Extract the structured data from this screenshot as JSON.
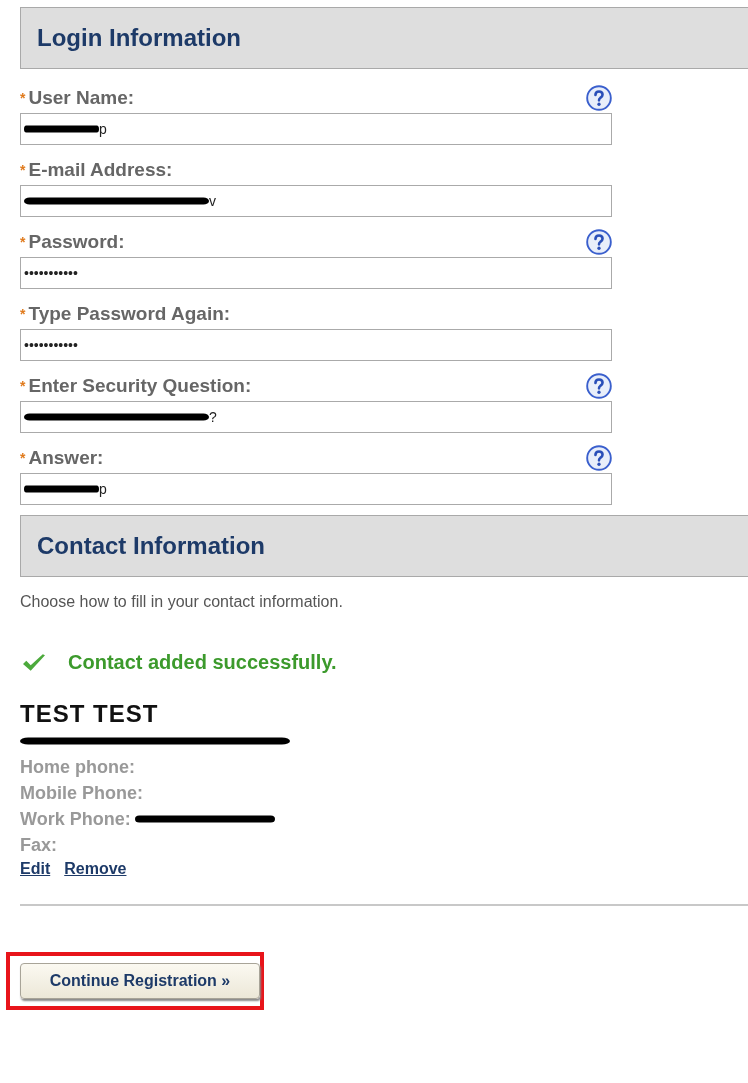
{
  "login": {
    "title": "Login Information",
    "fields": [
      {
        "label": "User Name:",
        "required": "*",
        "help": true,
        "redacted": true,
        "value": "p"
      },
      {
        "label": "E-mail Address:",
        "required": "*",
        "help": false,
        "redacted": true,
        "value": "v"
      },
      {
        "label": "Password:",
        "required": "*",
        "help": true,
        "redacted": false,
        "value": "•••••••••••"
      },
      {
        "label": "Type Password Again:",
        "required": "*",
        "help": false,
        "redacted": false,
        "value": "•••••••••••"
      },
      {
        "label": "Enter Security Question:",
        "required": "*",
        "help": true,
        "redacted": true,
        "value": "?"
      },
      {
        "label": "Answer:",
        "required": "*",
        "help": true,
        "redacted": true,
        "value": "p"
      }
    ]
  },
  "contact": {
    "title": "Contact Information",
    "intro": "Choose how to fill in your contact information.",
    "success": "Contact added successfully.",
    "name": "TEST  TEST",
    "lines": [
      {
        "redacted": true
      },
      {
        "text": "Home phone:",
        "redacted": false
      },
      {
        "text": "Mobile Phone:",
        "redacted": false
      },
      {
        "text": "Work Phone:",
        "redacted": true
      },
      {
        "text": "Fax:",
        "redacted": false
      }
    ],
    "links": [
      "Edit",
      "Remove"
    ]
  },
  "continue_button": {
    "label": "Continue Registration »",
    "highlighted": true
  }
}
